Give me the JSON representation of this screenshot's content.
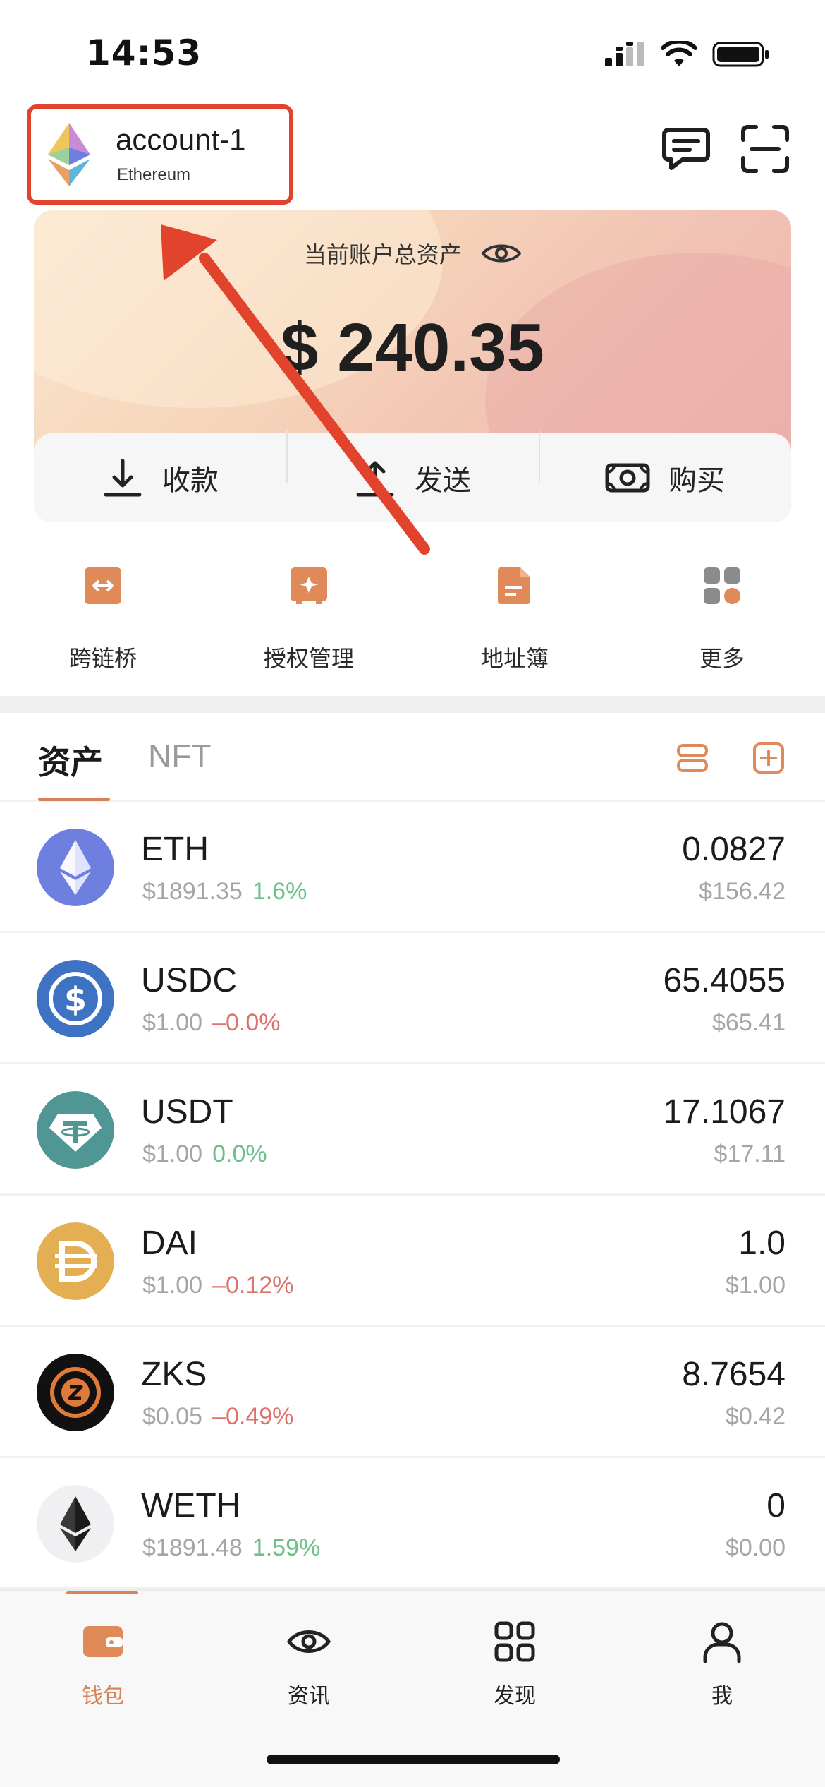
{
  "status_bar": {
    "time": "14:53"
  },
  "header": {
    "account_name": "account-1",
    "network": "Ethereum"
  },
  "balance_card": {
    "title": "当前账户总资产",
    "amount": "$ 240.35",
    "actions": [
      {
        "label": "收款",
        "icon": "download-icon"
      },
      {
        "label": "发送",
        "icon": "upload-icon"
      },
      {
        "label": "购买",
        "icon": "cash-icon"
      }
    ]
  },
  "shortcuts": [
    {
      "label": "跨链桥",
      "icon": "bridge-icon"
    },
    {
      "label": "授权管理",
      "icon": "authorization-icon"
    },
    {
      "label": "地址簿",
      "icon": "address-book-icon"
    },
    {
      "label": "更多",
      "icon": "more-grid-icon"
    }
  ],
  "tabs": {
    "assets": "资产",
    "nft": "NFT"
  },
  "assets": [
    {
      "symbol": "ETH",
      "price": "$1891.35",
      "change": "1.6%",
      "direction": "up",
      "amount": "0.0827",
      "value": "$156.42",
      "logo_color": "#6f7fe0"
    },
    {
      "symbol": "USDC",
      "price": "$1.00",
      "change": "–0.0%",
      "direction": "down",
      "amount": "65.4055",
      "value": "$65.41",
      "logo_color": "#3e73c4"
    },
    {
      "symbol": "USDT",
      "price": "$1.00",
      "change": "0.0%",
      "direction": "up",
      "amount": "17.1067",
      "value": "$17.11",
      "logo_color": "#4f9694"
    },
    {
      "symbol": "DAI",
      "price": "$1.00",
      "change": "–0.12%",
      "direction": "down",
      "amount": "1.0",
      "value": "$1.00",
      "logo_color": "#e4ae52"
    },
    {
      "symbol": "ZKS",
      "price": "$0.05",
      "change": "–0.49%",
      "direction": "down",
      "amount": "8.7654",
      "value": "$0.42",
      "logo_color": "#111111"
    },
    {
      "symbol": "WETH",
      "price": "$1891.48",
      "change": "1.59%",
      "direction": "up",
      "amount": "0",
      "value": "$0.00",
      "logo_color": "#f0f0f3"
    }
  ],
  "bottom_nav": [
    {
      "label": "钱包",
      "icon": "wallet-icon",
      "active": true
    },
    {
      "label": "资讯",
      "icon": "eye-icon",
      "active": false
    },
    {
      "label": "发现",
      "icon": "grid-icon",
      "active": false
    },
    {
      "label": "我",
      "icon": "person-icon",
      "active": false
    }
  ],
  "colors": {
    "accent": "#d88356",
    "annotation": "#e2432c",
    "up": "#6cc08a",
    "down": "#e0706a"
  }
}
